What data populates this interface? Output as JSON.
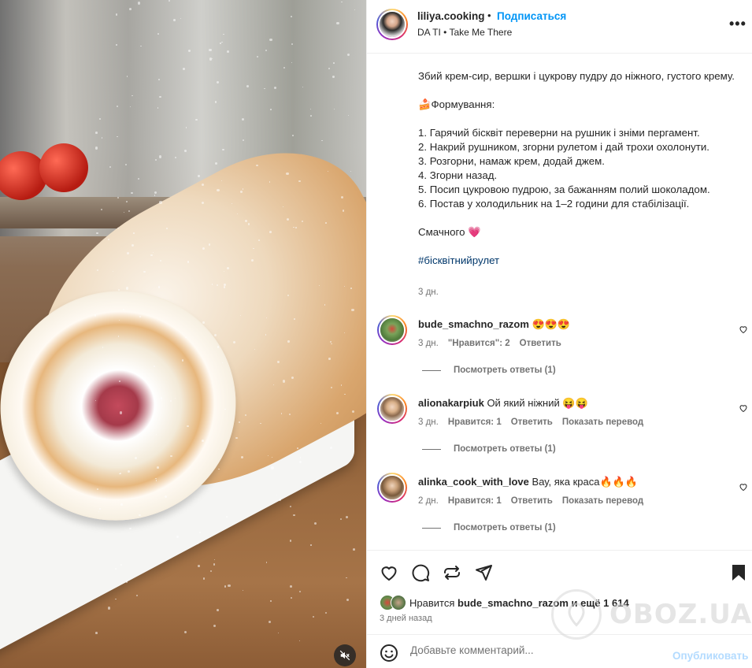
{
  "header": {
    "username": "liliya.cooking",
    "separator": "•",
    "follow_label": "Подписаться",
    "music": "DA TI • Take Me There",
    "more_icon": "more-horizontal-icon"
  },
  "caption": {
    "paragraph1": "Збий крем-сир, вершки і цукрову пудру до ніжного, густого крему.",
    "section_title": "🍰Формування:",
    "steps": [
      "1. Гарячий бісквіт переверни на рушник і зніми пергамент.",
      "2. Накрий рушником, згорни рулетом і дай трохи охолонути.",
      "3. Розгорни, намаж крем, додай джем.",
      "4. Згорни назад.",
      "5. Посип цукровою пудрою, за бажанням полий шоколадом.",
      "6. Постав у холодильник на 1–2 години для стабілізації."
    ],
    "closing": "Смачного 💗",
    "hashtag": "#бісквітнийрулет",
    "time": "3 дн."
  },
  "comments": [
    {
      "username": "bude_smachno_razom",
      "text": "😍😍😍",
      "time": "3 дн.",
      "likes": "\"Нравится\": 2",
      "reply": "Ответить",
      "translate": "",
      "view_replies": "Посмотреть ответы (1)",
      "avatar_color": "#6b8f4e"
    },
    {
      "username": "alionakarpiuk",
      "text": "Ой який ніжний 😝😝",
      "time": "3 дн.",
      "likes": "Нравится: 1",
      "reply": "Ответить",
      "translate": "Показать перевод",
      "view_replies": "Посмотреть ответы (1)",
      "avatar_color": "#c9a58a"
    },
    {
      "username": "alinka_cook_with_love",
      "text": "Вау, яка краса🔥🔥🔥",
      "time": "2 дн.",
      "likes": "Нравится: 1",
      "reply": "Ответить",
      "translate": "Показать перевод",
      "view_replies": "Посмотреть ответы (1)",
      "avatar_color": "#a7865f"
    }
  ],
  "actions": {
    "icons": [
      "heart-icon",
      "comment-icon",
      "repost-icon",
      "share-icon",
      "bookmark-icon"
    ],
    "likes_prefix": "Нравится",
    "likes_user": "bude_smachno_razom",
    "likes_suffix": "и ещё 1 614",
    "post_time": "3 дней назад"
  },
  "add_comment": {
    "placeholder": "Добавьте комментарий...",
    "publish_label": "Опубликовать"
  },
  "watermark": {
    "text": "OBOZ.UA"
  },
  "colors": {
    "link_blue": "#0095f6",
    "publish_disabled": "#b3dbff",
    "hashtag": "#00376b",
    "secondary_text": "#737373"
  }
}
